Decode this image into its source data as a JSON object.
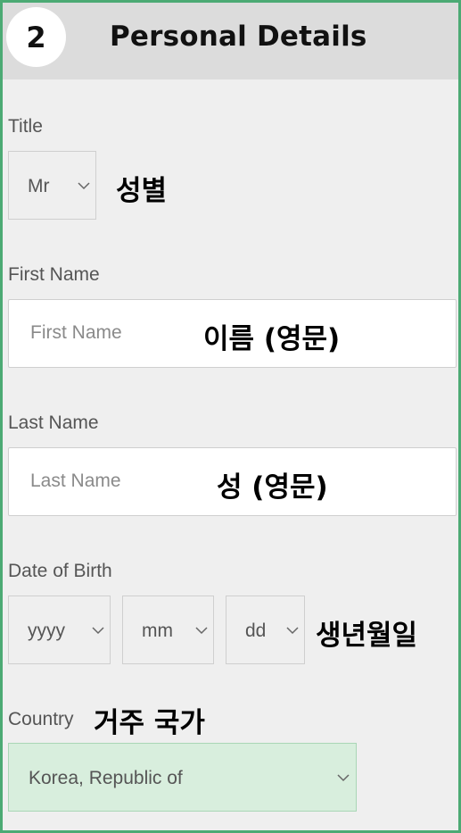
{
  "header": {
    "step": "2",
    "title": "Personal Details"
  },
  "title_field": {
    "label": "Title",
    "value": "Mr",
    "annotation": "성별"
  },
  "first_name": {
    "label": "First Name",
    "placeholder": "First Name",
    "annotation": "이름 (영문)"
  },
  "last_name": {
    "label": "Last Name",
    "placeholder": "Last Name",
    "annotation": "성 (영문)"
  },
  "dob": {
    "label": "Date of Birth",
    "year": "yyyy",
    "month": "mm",
    "day": "dd",
    "annotation": "생년월일"
  },
  "country": {
    "label": "Country",
    "value": "Korea, Republic of",
    "annotation": "거주 국가"
  },
  "colors": {
    "accent_border": "#4caa74",
    "country_bg": "#d8eedd"
  },
  "icons": {
    "dropdown": "chevron-down-icon"
  }
}
